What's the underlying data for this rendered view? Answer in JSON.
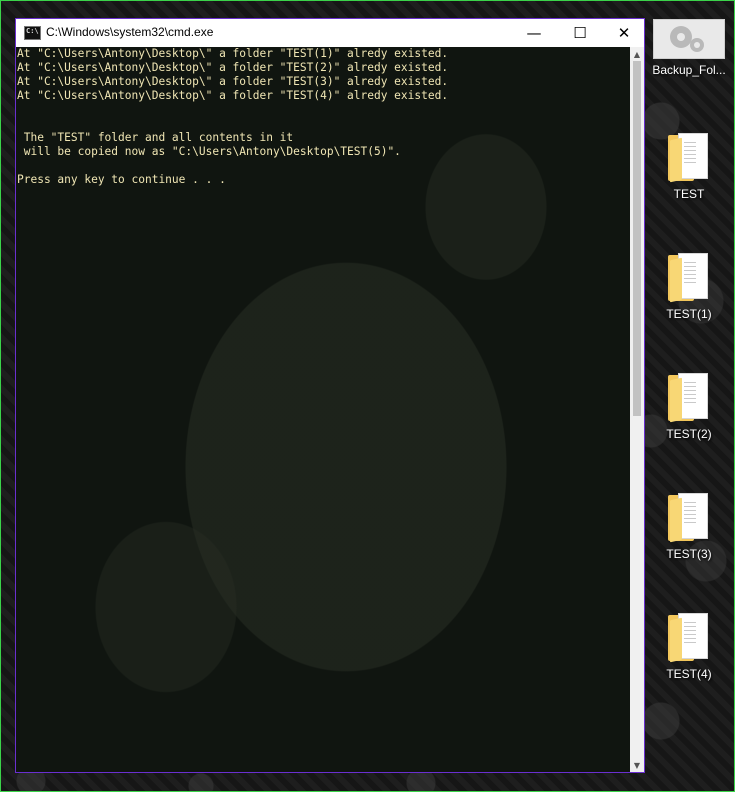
{
  "window": {
    "title": "C:\\Windows\\system32\\cmd.exe",
    "buttons": {
      "minimize": "—",
      "maximize": "☐",
      "close": "✕"
    }
  },
  "console": {
    "lines": [
      "At \"C:\\Users\\Antony\\Desktop\\\" a folder \"TEST(1)\" alredy existed.",
      "At \"C:\\Users\\Antony\\Desktop\\\" a folder \"TEST(2)\" alredy existed.",
      "At \"C:\\Users\\Antony\\Desktop\\\" a folder \"TEST(3)\" alredy existed.",
      "At \"C:\\Users\\Antony\\Desktop\\\" a folder \"TEST(4)\" alredy existed.",
      "",
      "",
      " The \"TEST\" folder and all contents in it",
      " will be copied now as \"C:\\Users\\Antony\\Desktop\\TEST(5)\".",
      "",
      "Press any key to continue . . ."
    ],
    "text_color": "#f0e6b4"
  },
  "scrollbar": {
    "up_arrow": "▲",
    "down_arrow": "▼"
  },
  "desktop_icons": [
    {
      "label": "Backup_Fol...",
      "icon": "gears-icon"
    },
    {
      "label": "TEST",
      "icon": "folder-icon"
    },
    {
      "label": "TEST(1)",
      "icon": "folder-icon"
    },
    {
      "label": "TEST(2)",
      "icon": "folder-icon"
    },
    {
      "label": "TEST(3)",
      "icon": "folder-icon"
    },
    {
      "label": "TEST(4)",
      "icon": "folder-icon"
    }
  ],
  "colors": {
    "window_border": "#6a2fd0",
    "screen_border": "#3bd34a",
    "folder": "#f3c75b"
  }
}
